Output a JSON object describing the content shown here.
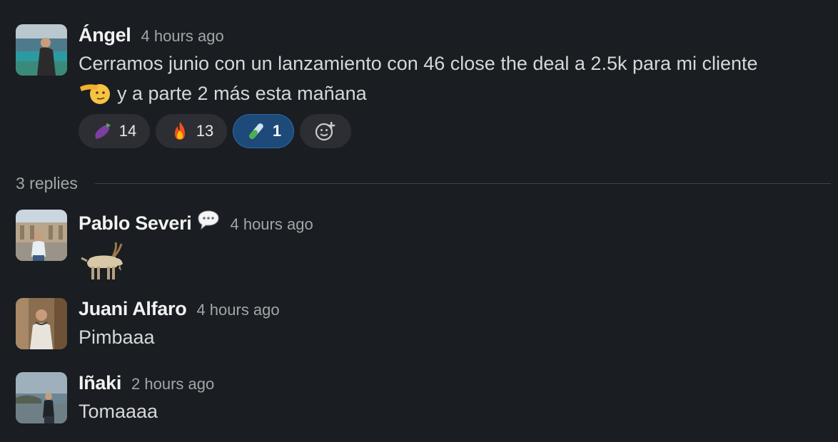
{
  "thread": {
    "parent": {
      "author": "Ángel",
      "time": "4 hours ago",
      "line1": "Cerramos junio con un lanzamiento con 46 close the deal a 2.5k para mi cliente",
      "line2": "y a parte 2 más esta mañana",
      "inline_emoji": "saluting-face-icon",
      "reactions": [
        {
          "icon": "eggplant-icon",
          "count": "14",
          "active": false
        },
        {
          "icon": "fire-icon",
          "count": "13",
          "active": false
        },
        {
          "icon": "test-tube-icon",
          "count": "1",
          "active": true
        }
      ],
      "add_reaction_icon": "add-reaction-icon"
    },
    "replies_label": "3 replies",
    "replies": [
      {
        "author": "Pablo Severi",
        "status_icon": "speech-balloon-icon",
        "time": "4 hours ago",
        "body_emoji": "goat-icon"
      },
      {
        "author": "Juani Alfaro",
        "time": "4 hours ago",
        "text": "Pimbaaa"
      },
      {
        "author": "Iñaki",
        "time": "2 hours ago",
        "text": "Tomaaaa"
      }
    ]
  },
  "colors": {
    "background": "#1a1d21",
    "reaction_bg": "#2c2e33",
    "reaction_active_bg": "#1d4a78",
    "text": "#d6d7d8",
    "muted": "#a3a5a8"
  }
}
